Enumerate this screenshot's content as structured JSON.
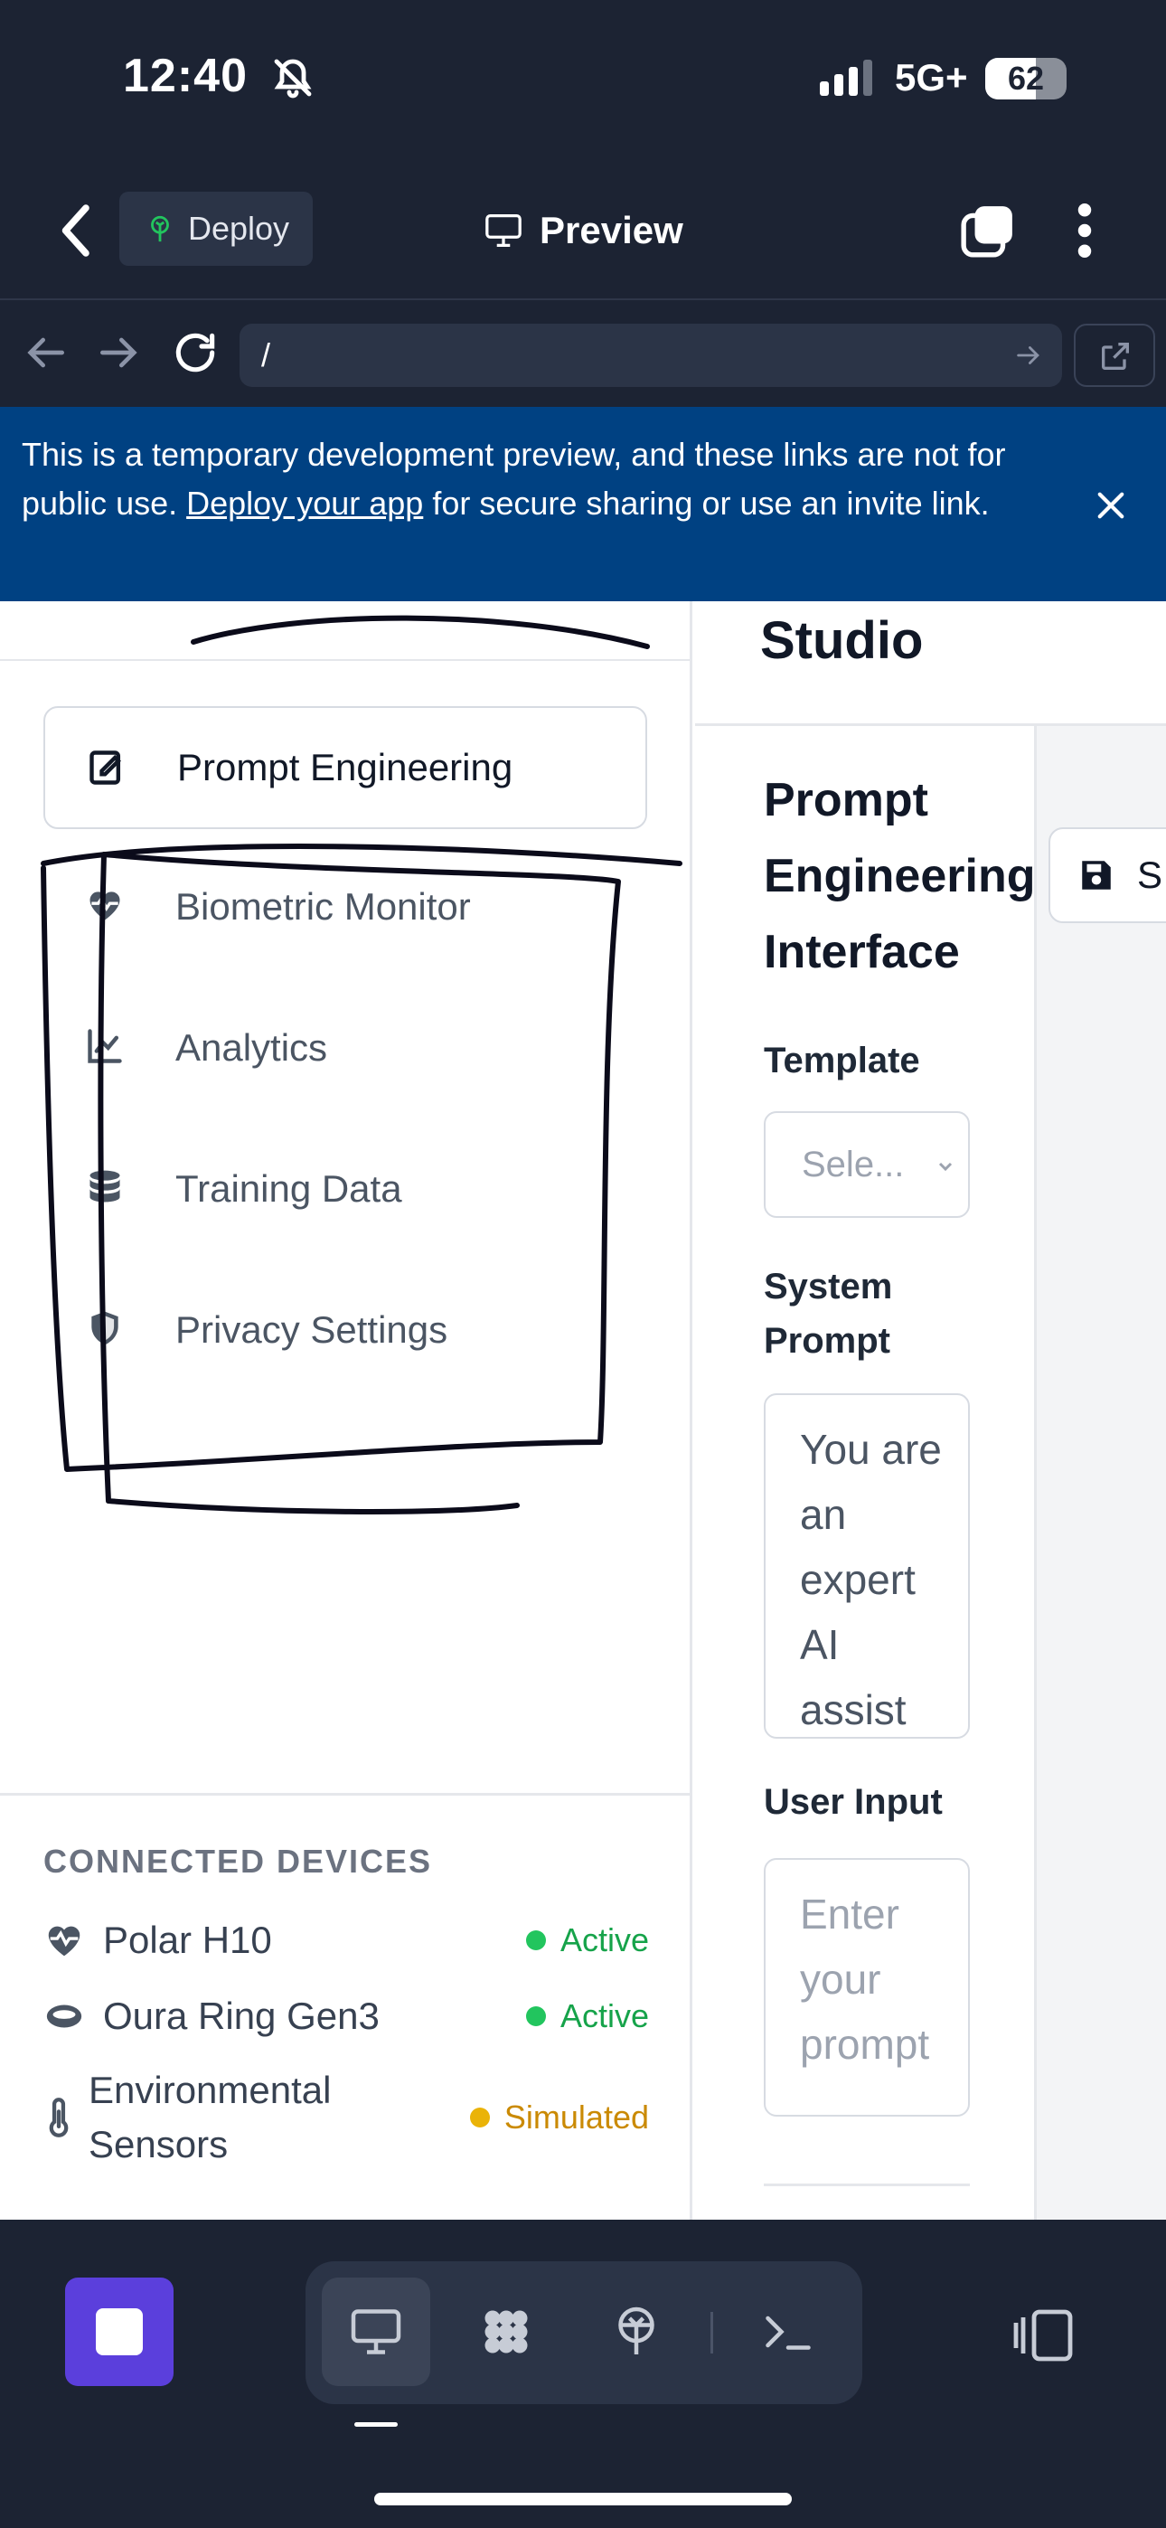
{
  "status_bar": {
    "time": "12:40",
    "network": "5G+",
    "battery": "62",
    "battery_level": 0.62
  },
  "header": {
    "deploy_label": "Deploy",
    "preview_label": "Preview"
  },
  "url_bar": {
    "url": "/"
  },
  "banner": {
    "text_before": "This is a temporary development preview, and these links are not for public use.",
    "link_text": "Deploy your app",
    "text_after": "for secure sharing or use an invite link."
  },
  "sidebar": {
    "items": [
      {
        "label": "Prompt Engineering",
        "icon": "edit-icon",
        "active": true
      },
      {
        "label": "Biometric Monitor",
        "icon": "heart-pulse-icon",
        "active": false
      },
      {
        "label": "Analytics",
        "icon": "chart-line-icon",
        "active": false
      },
      {
        "label": "Training Data",
        "icon": "database-icon",
        "active": false
      },
      {
        "label": "Privacy Settings",
        "icon": "shield-icon",
        "active": false
      }
    ],
    "devices_title": "CONNECTED DEVICES",
    "devices": [
      {
        "name": "Polar H10",
        "status": "Active",
        "icon": "heart-pulse-icon",
        "status_color": "#22c55e",
        "text_color": "#16a34a"
      },
      {
        "name": "Oura Ring Gen3",
        "status": "Active",
        "icon": "ring-icon",
        "status_color": "#22c55e",
        "text_color": "#16a34a"
      },
      {
        "name": "Environmental Sensors",
        "status": "Simulated",
        "icon": "thermometer-icon",
        "status_color": "#eab308",
        "text_color": "#ca8a04"
      }
    ]
  },
  "main": {
    "title": "Studio",
    "panel_title": "Prompt Engineering Interface",
    "save_label": "S",
    "template_label": "Template",
    "template_placeholder": "Sele...",
    "system_prompt_label": "System Prompt",
    "system_prompt_value": "You are an expert AI assist",
    "user_input_label": "User Input",
    "user_input_placeholder": "Enter your prompt"
  },
  "colors": {
    "accent": "#5b3fdc",
    "banner": "#004182",
    "chrome": "#1c2333"
  }
}
